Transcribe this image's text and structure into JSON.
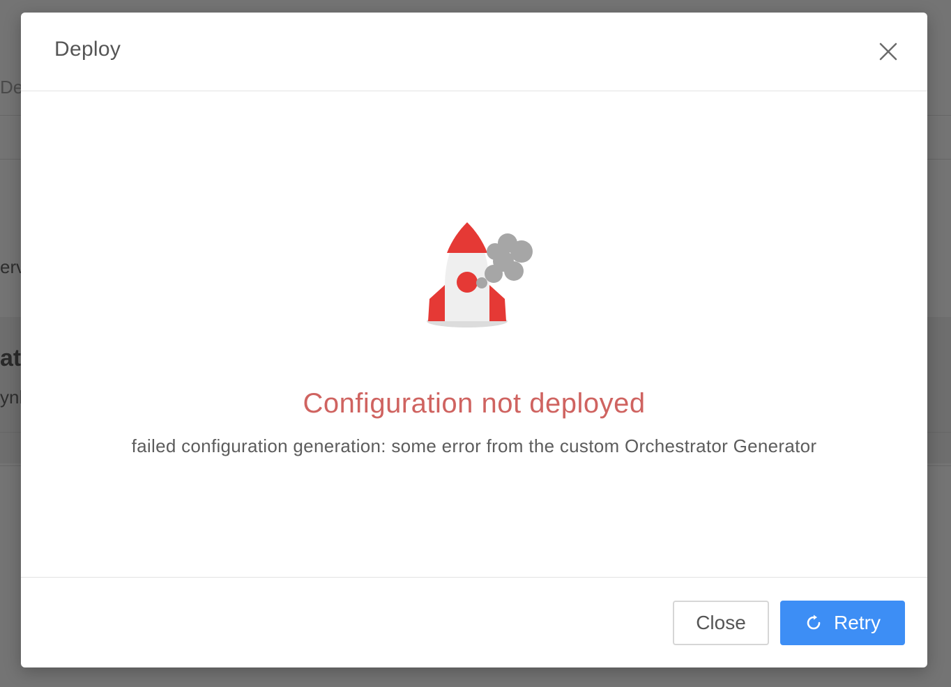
{
  "modal": {
    "title": "Deploy",
    "close_icon": "close-icon"
  },
  "body": {
    "illustration": "crashed-rocket-icon",
    "error_title": "Configuration not deployed",
    "error_message": "failed configuration generation: some error from the custom Orchestrator Generator"
  },
  "footer": {
    "close_label": "Close",
    "retry_label": "Retry",
    "retry_icon": "refresh-icon"
  },
  "background": {
    "fragment_1": "Depl",
    "fragment_2": "ervi",
    "fragment_3": "ati",
    "fragment_4": "ynl"
  },
  "colors": {
    "error_text": "#cf6360",
    "primary_button": "#3d8ef5",
    "rocket_red": "#e53935",
    "smoke_gray": "#a6a6a6",
    "overlay": "#747474"
  }
}
